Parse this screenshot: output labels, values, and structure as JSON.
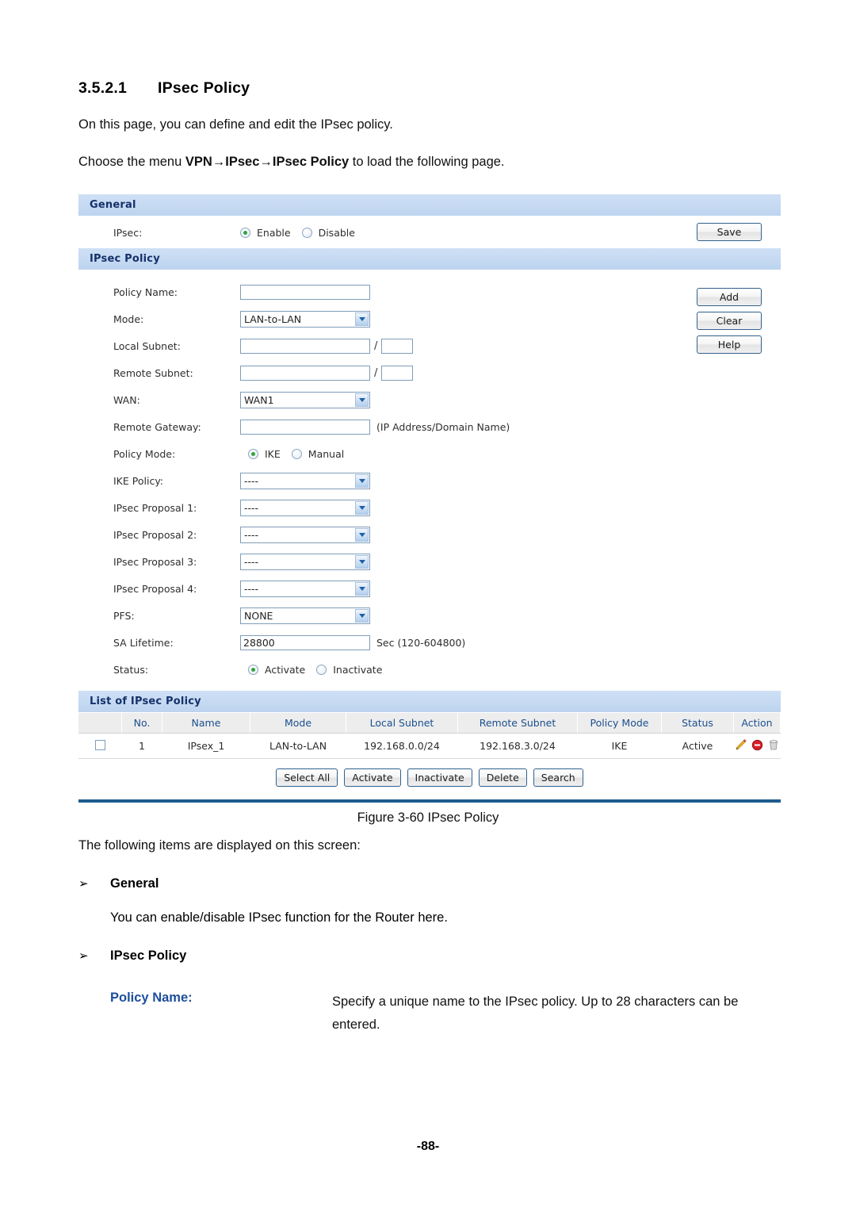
{
  "document": {
    "section_number": "3.5.2.1",
    "section_title": "IPsec Policy",
    "intro": "On this page, you can define and edit the IPsec policy.",
    "menu_lead": "Choose the menu ",
    "menu_path": "VPN→IPsec→IPsec Policy",
    "menu_tail": " to load the following page.",
    "figure_caption": "Figure 3-60 IPsec Policy",
    "items_lead": "The following items are displayed on this screen:",
    "bullet_glyph": "➢",
    "bullets": [
      {
        "title": "General",
        "body": "You can enable/disable IPsec function for the Router here."
      },
      {
        "title": "IPsec Policy",
        "body": ""
      }
    ],
    "definitions": [
      {
        "term": "Policy Name:",
        "description": "Specify a unique name to the IPsec policy. Up to 28 characters can be entered."
      }
    ],
    "page_number": "-88-",
    "accent_color": "#1d4e9c"
  },
  "panel": {
    "general": {
      "header": "General",
      "ipsec_label": "IPsec:",
      "radios": [
        {
          "label": "Enable",
          "selected": true
        },
        {
          "label": "Disable",
          "selected": false
        }
      ],
      "save_label": "Save"
    },
    "policy": {
      "header": "IPsec Policy",
      "fields": [
        {
          "label": "Policy Name:",
          "type": "text",
          "value": ""
        },
        {
          "label": "Mode:",
          "type": "select",
          "value": "LAN-to-LAN"
        },
        {
          "label": "Local Subnet:",
          "type": "subnet",
          "value": "",
          "mask": ""
        },
        {
          "label": "Remote Subnet:",
          "type": "subnet",
          "value": "",
          "mask": ""
        },
        {
          "label": "WAN:",
          "type": "select",
          "value": "WAN1"
        },
        {
          "label": "Remote Gateway:",
          "type": "text",
          "value": "",
          "hint": "(IP Address/Domain Name)"
        },
        {
          "label": "Policy Mode:",
          "type": "radio",
          "options": [
            {
              "label": "IKE",
              "selected": true
            },
            {
              "label": "Manual",
              "selected": false
            }
          ]
        },
        {
          "label": "IKE Policy:",
          "type": "select",
          "value": "----"
        },
        {
          "label": "IPsec Proposal 1:",
          "type": "select",
          "value": "----"
        },
        {
          "label": "IPsec Proposal 2:",
          "type": "select",
          "value": "----"
        },
        {
          "label": "IPsec Proposal 3:",
          "type": "select",
          "value": "----"
        },
        {
          "label": "IPsec Proposal 4:",
          "type": "select",
          "value": "----"
        },
        {
          "label": "PFS:",
          "type": "select",
          "value": "NONE"
        },
        {
          "label": "SA Lifetime:",
          "type": "text",
          "value": "28800",
          "hint": "Sec (120-604800)"
        },
        {
          "label": "Status:",
          "type": "radio",
          "options": [
            {
              "label": "Activate",
              "selected": true
            },
            {
              "label": "Inactivate",
              "selected": false
            }
          ]
        }
      ],
      "side_buttons": [
        {
          "label": "Add"
        },
        {
          "label": "Clear"
        },
        {
          "label": "Help"
        }
      ]
    },
    "list": {
      "header": "List of IPsec Policy",
      "columns": [
        "",
        "No.",
        "Name",
        "Mode",
        "Local Subnet",
        "Remote Subnet",
        "Policy Mode",
        "Status",
        "Action"
      ],
      "rows": [
        {
          "checked": false,
          "no": "1",
          "name": "IPsex_1",
          "mode": "LAN-to-LAN",
          "local_subnet": "192.168.0.0/24",
          "remote_subnet": "192.168.3.0/24",
          "policy_mode": "IKE",
          "status": "Active",
          "actions": [
            "edit-pencil-icon",
            "disable-circle-icon",
            "delete-trash-icon"
          ]
        }
      ],
      "toolbar": [
        "Select All",
        "Activate",
        "Inactivate",
        "Delete",
        "Search"
      ]
    }
  }
}
